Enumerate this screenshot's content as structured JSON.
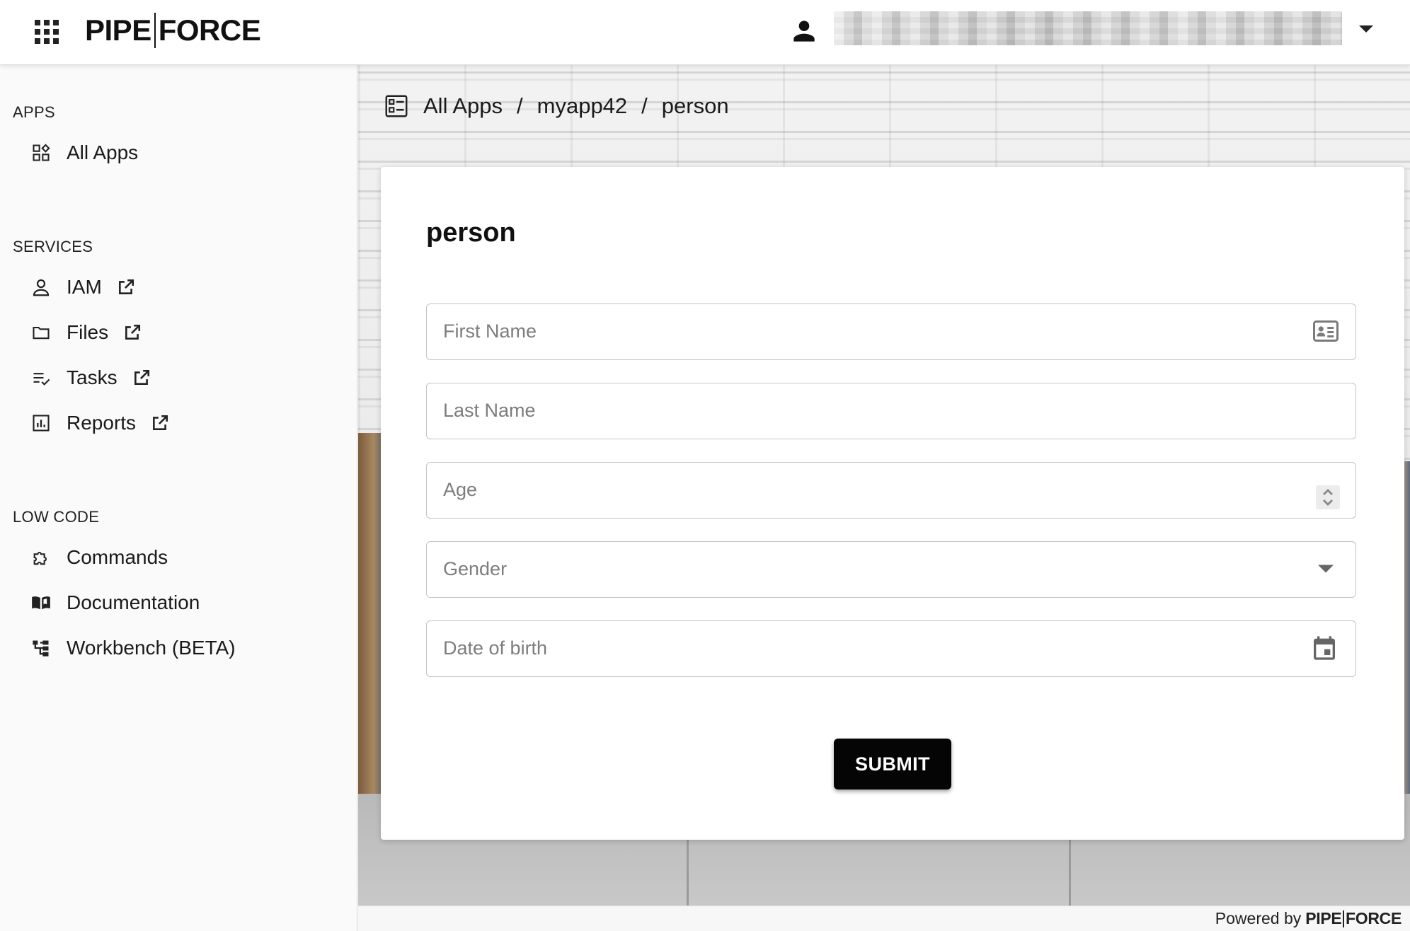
{
  "header": {
    "logo_left": "PIPE",
    "logo_right": "FORCE",
    "apps_icon": "apps-grid-icon",
    "user_icon": "person-icon",
    "user_name": ""
  },
  "sidebar": {
    "sections": [
      {
        "title": "APPS",
        "items": [
          {
            "label": "All Apps",
            "icon": "widgets-icon",
            "external": false
          }
        ]
      },
      {
        "title": "SERVICES",
        "items": [
          {
            "label": "IAM",
            "icon": "person-outline-icon",
            "external": true
          },
          {
            "label": "Files",
            "icon": "folder-icon",
            "external": true
          },
          {
            "label": "Tasks",
            "icon": "checklist-icon",
            "external": true
          },
          {
            "label": "Reports",
            "icon": "bar-chart-icon",
            "external": true
          }
        ]
      },
      {
        "title": "LOW CODE",
        "items": [
          {
            "label": "Commands",
            "icon": "puzzle-icon",
            "external": false
          },
          {
            "label": "Documentation",
            "icon": "book-icon",
            "external": false
          },
          {
            "label": "Workbench (BETA)",
            "icon": "tree-icon",
            "external": false
          }
        ]
      }
    ]
  },
  "breadcrumb": {
    "icon": "app-list-icon",
    "items": [
      "All Apps",
      "myapp42",
      "person"
    ],
    "separator": "/"
  },
  "form": {
    "title": "person",
    "fields": [
      {
        "placeholder": "First Name",
        "adornment": "contact-card-icon"
      },
      {
        "placeholder": "Last Name",
        "adornment": ""
      },
      {
        "placeholder": "Age",
        "adornment": "number-spinner-icon"
      },
      {
        "placeholder": "Gender",
        "adornment": "dropdown-arrow-icon"
      },
      {
        "placeholder": "Date of birth",
        "adornment": "calendar-icon"
      }
    ],
    "submit_label": "SUBMIT"
  },
  "footer": {
    "powered_by": "Powered by",
    "logo_left": "PIPE",
    "logo_right": "FORCE"
  },
  "colors": {
    "primary_button": "#050505",
    "text": "#1a1a1a",
    "placeholder": "#7d7d7d",
    "field_border": "#c4c4c4"
  }
}
